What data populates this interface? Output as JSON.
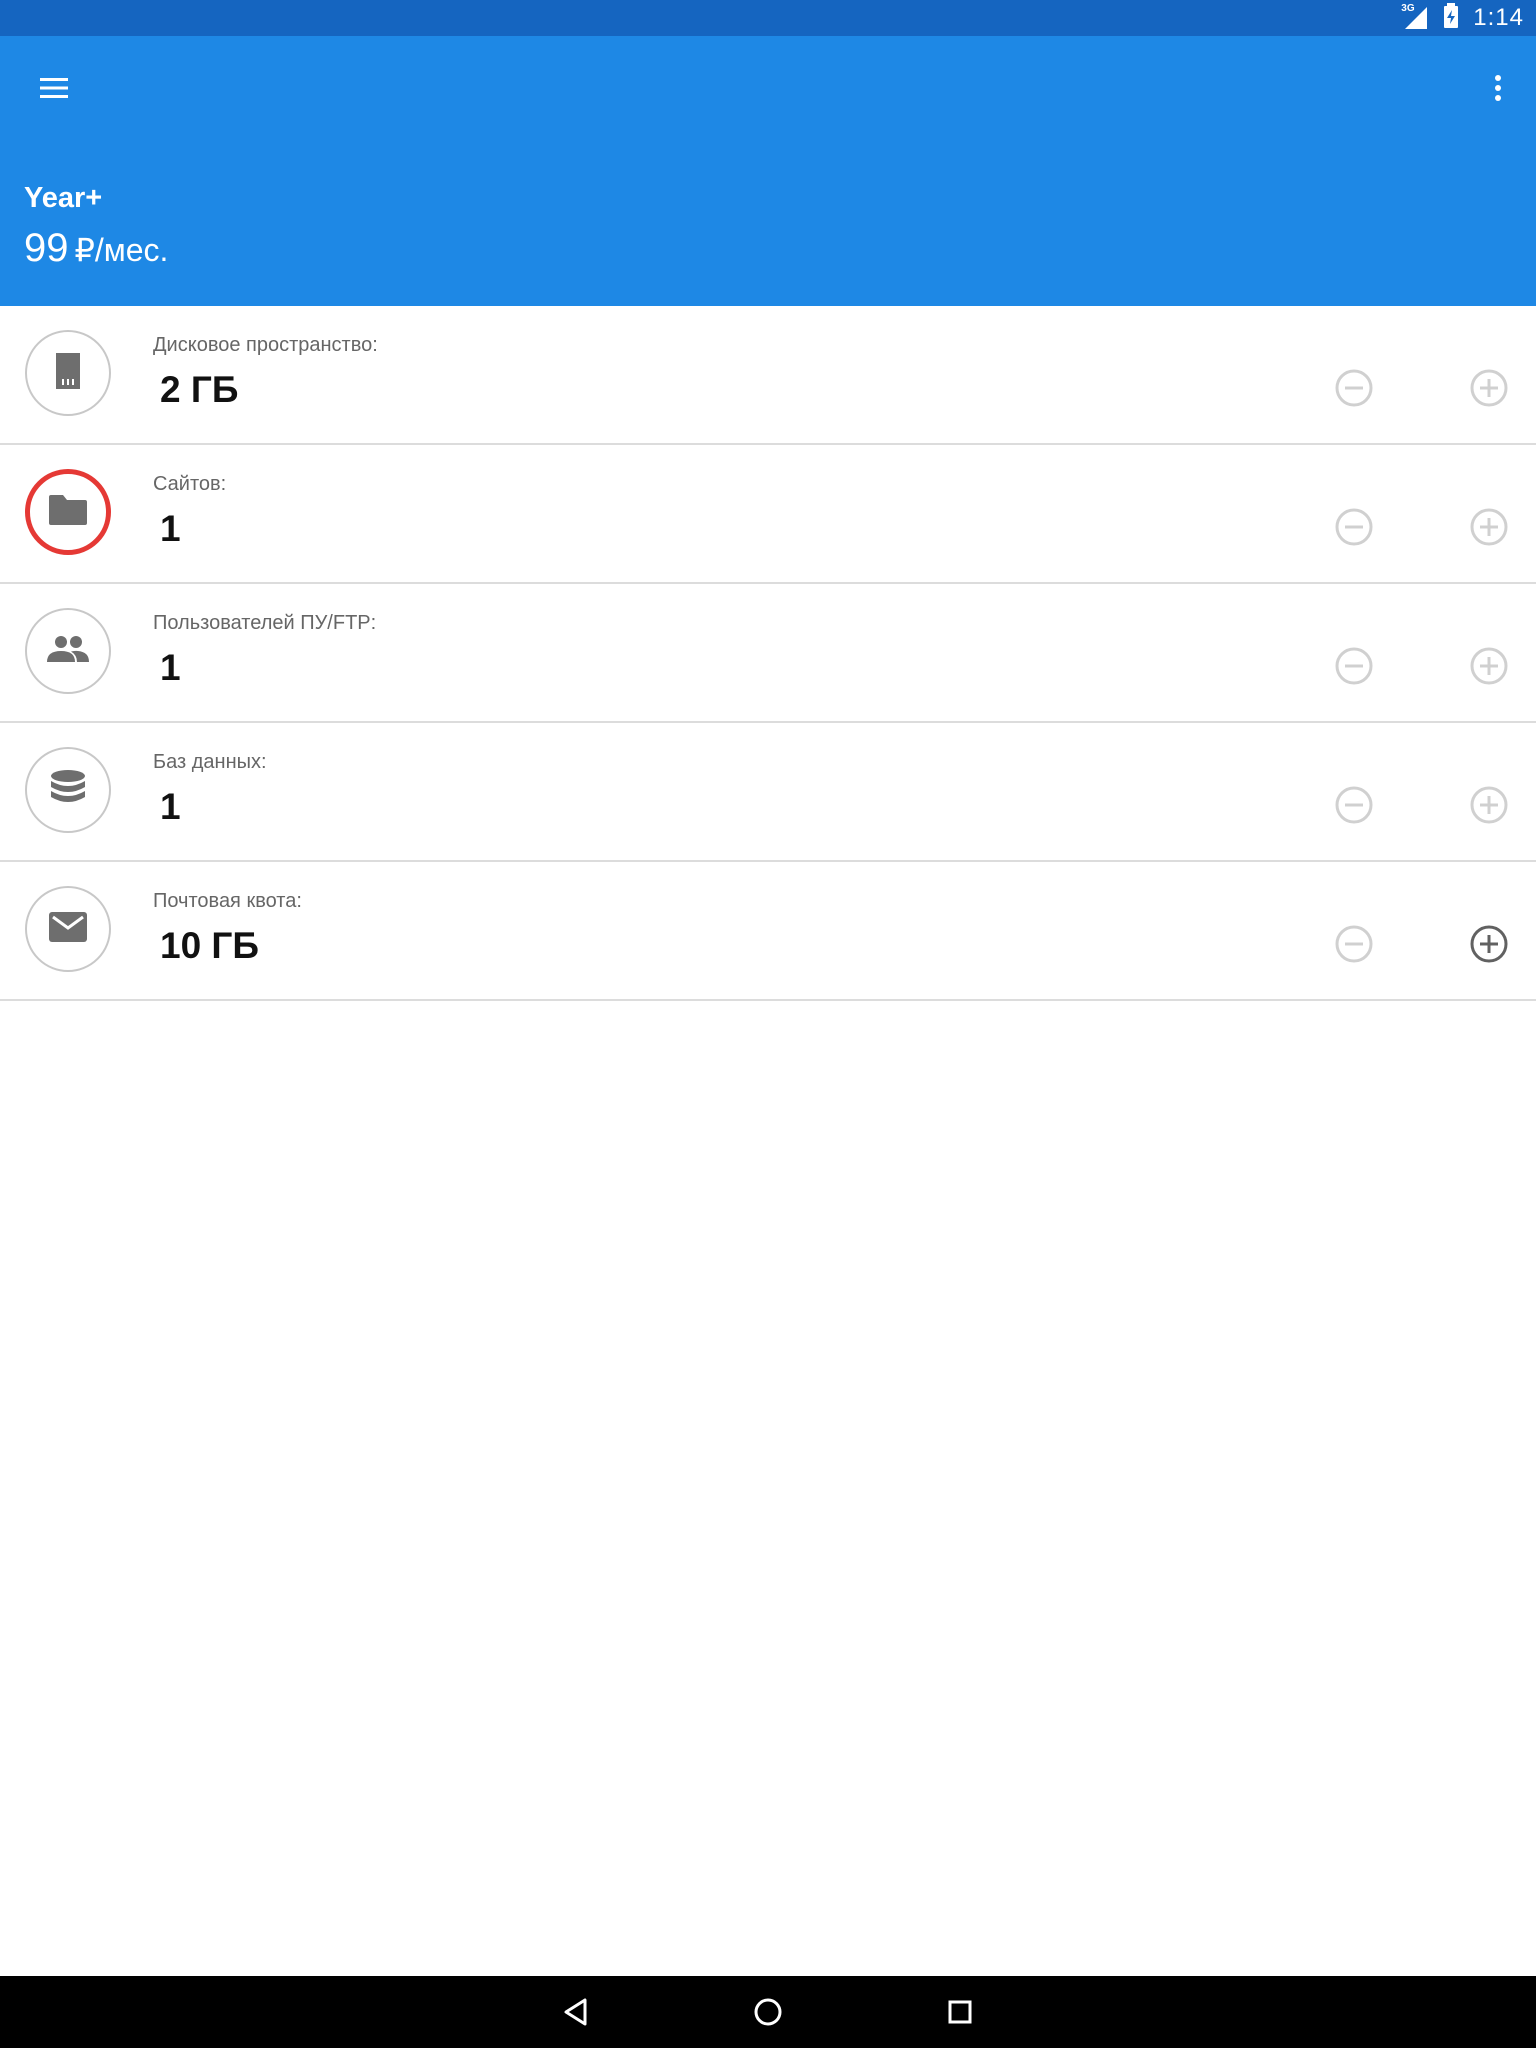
{
  "status_bar": {
    "time": "1:14",
    "network": "3G"
  },
  "app_bar": {
    "plan_name": "Year+",
    "price_value": "99",
    "price_unit": "₽/мес."
  },
  "rows": [
    {
      "label": "Дисковое пространство:",
      "value": "2 ГБ",
      "icon": "sd-card-icon",
      "highlight": false,
      "plus_enabled": false
    },
    {
      "label": "Сайтов:",
      "value": "1",
      "icon": "folder-icon",
      "highlight": true,
      "plus_enabled": false
    },
    {
      "label": "Пользователей ПУ/FTP:",
      "value": "1",
      "icon": "users-icon",
      "highlight": false,
      "plus_enabled": false
    },
    {
      "label": "Баз данных:",
      "value": "1",
      "icon": "database-icon",
      "highlight": false,
      "plus_enabled": false
    },
    {
      "label": "Почтовая квота:",
      "value": "10 ГБ",
      "icon": "mail-icon",
      "highlight": false,
      "plus_enabled": true
    }
  ],
  "colors": {
    "status_bar": "#1565c0",
    "app_bar": "#1e88e5",
    "highlight_ring": "#e53935",
    "disabled_control": "#d0d0d0",
    "enabled_control": "#616161"
  }
}
